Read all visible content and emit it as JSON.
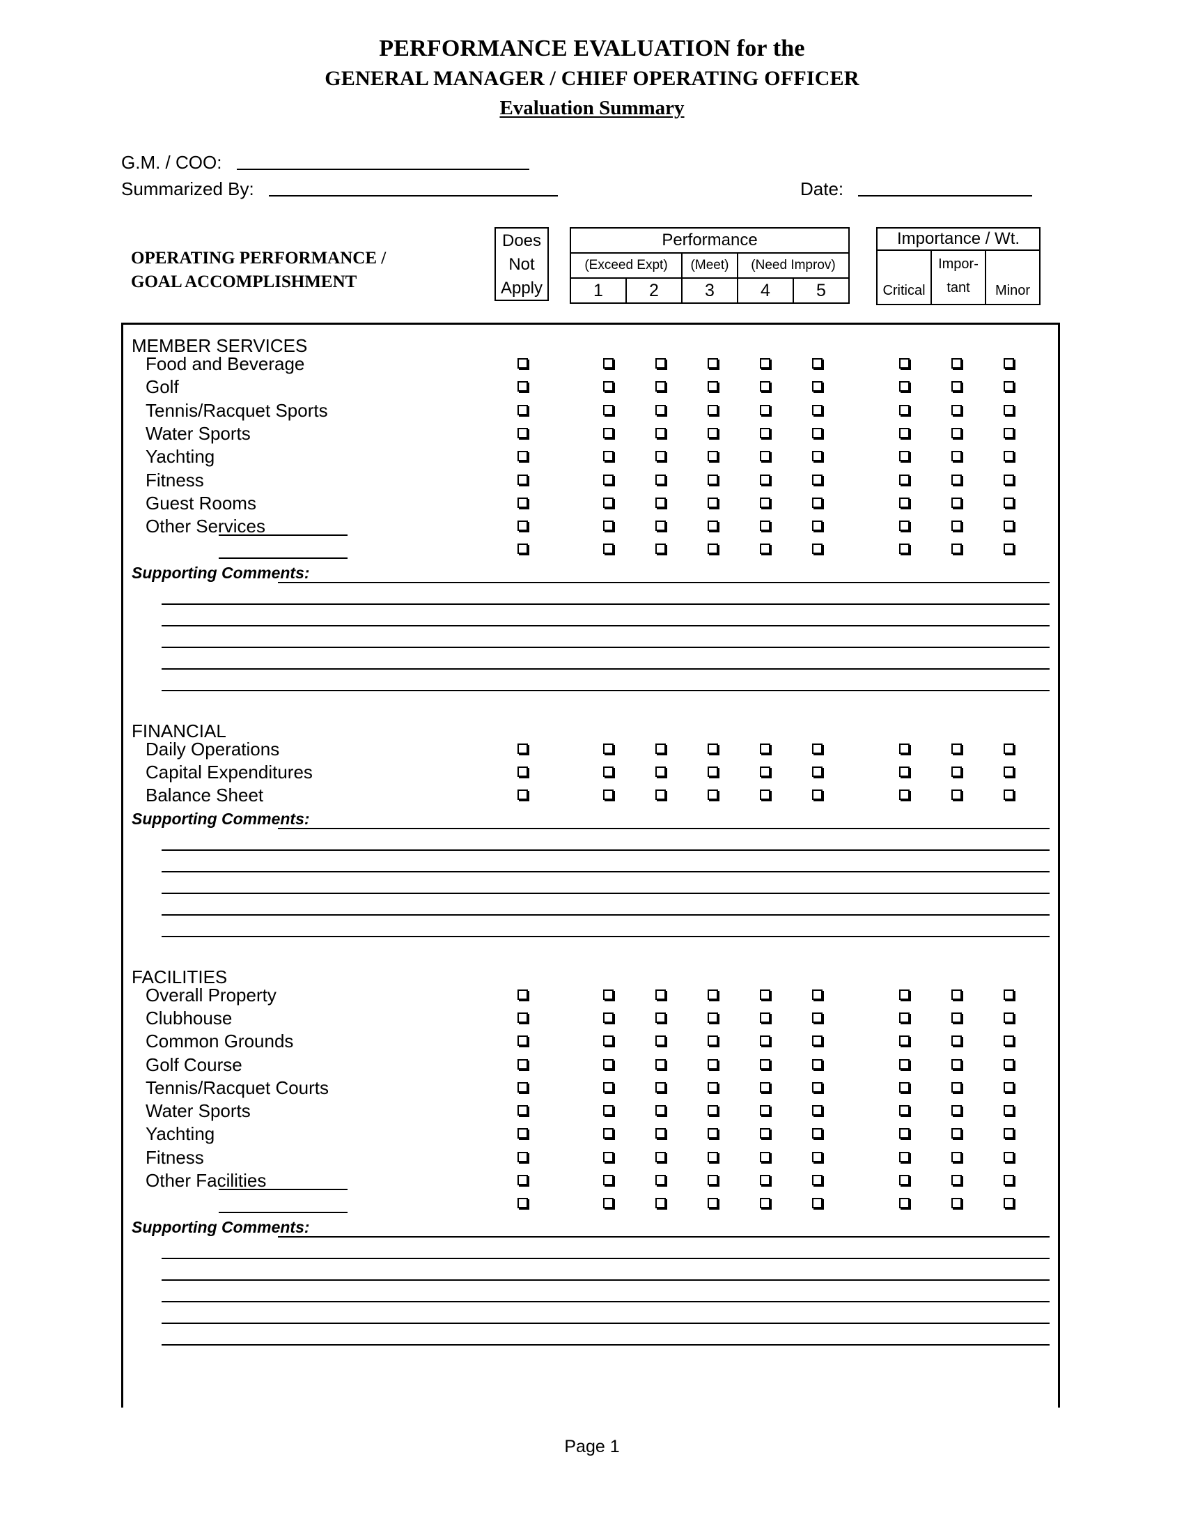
{
  "document": {
    "title_line1": "PERFORMANCE EVALUATION for the",
    "title_line2": "GENERAL MANAGER / CHIEF OPERATING OFFICER",
    "title_line3": "Evaluation Summary",
    "footer": "Page 1"
  },
  "identification": {
    "gm_coo_label": "G.M. / COO:",
    "summarized_by_label": "Summarized By:",
    "date_label": "Date:",
    "gm_coo_value": "",
    "summarized_by_value": "",
    "date_value": ""
  },
  "header": {
    "left_title_line1": "OPERATING PERFORMANCE /",
    "left_title_line2": "GOAL ACCOMPLISHMENT",
    "does_not_apply": {
      "line1": "Does",
      "line2": "Not",
      "line3": "Apply"
    },
    "performance": {
      "title": "Performance",
      "group_labels": [
        "(Exceed Expt)",
        "(Meet)",
        "(Need Improv)"
      ],
      "scale": [
        "1",
        "2",
        "3",
        "4",
        "5"
      ]
    },
    "importance": {
      "title": "Importance / Wt.",
      "levels": [
        "Critical",
        "Impor-",
        "tant",
        "Minor"
      ],
      "level_critical": "Critical",
      "level_important_line1": "Impor-",
      "level_important_line2": "tant",
      "level_minor": "Minor"
    }
  },
  "sections": [
    {
      "name": "MEMBER SERVICES",
      "items": [
        "Food and Beverage",
        "Golf",
        "Tennis/Racquet Sports",
        "Water Sports",
        "Yachting",
        "Fitness",
        "Guest Rooms",
        "Other Services"
      ],
      "other_label": "Other Services",
      "has_blank_write_in_row": true,
      "comments_label": "Supporting Comments:",
      "comment_lines": 6
    },
    {
      "name": "FINANCIAL",
      "items": [
        "Daily Operations",
        "Capital Expenditures",
        "Balance Sheet"
      ],
      "has_blank_write_in_row": false,
      "comments_label": "Supporting Comments:",
      "comment_lines": 6
    },
    {
      "name": "FACILITIES",
      "items": [
        "Overall Property",
        "Clubhouse",
        "Common Grounds",
        "Golf Course",
        "Tennis/Racquet Courts",
        "Water Sports",
        "Yachting",
        "Fitness",
        "Other Facilities"
      ],
      "other_label": "Other Facilities",
      "has_blank_write_in_row": true,
      "comments_label": "Supporting Comments:",
      "comment_lines": 6
    }
  ],
  "colors": {
    "ink": "#000000",
    "paper": "#ffffff"
  }
}
